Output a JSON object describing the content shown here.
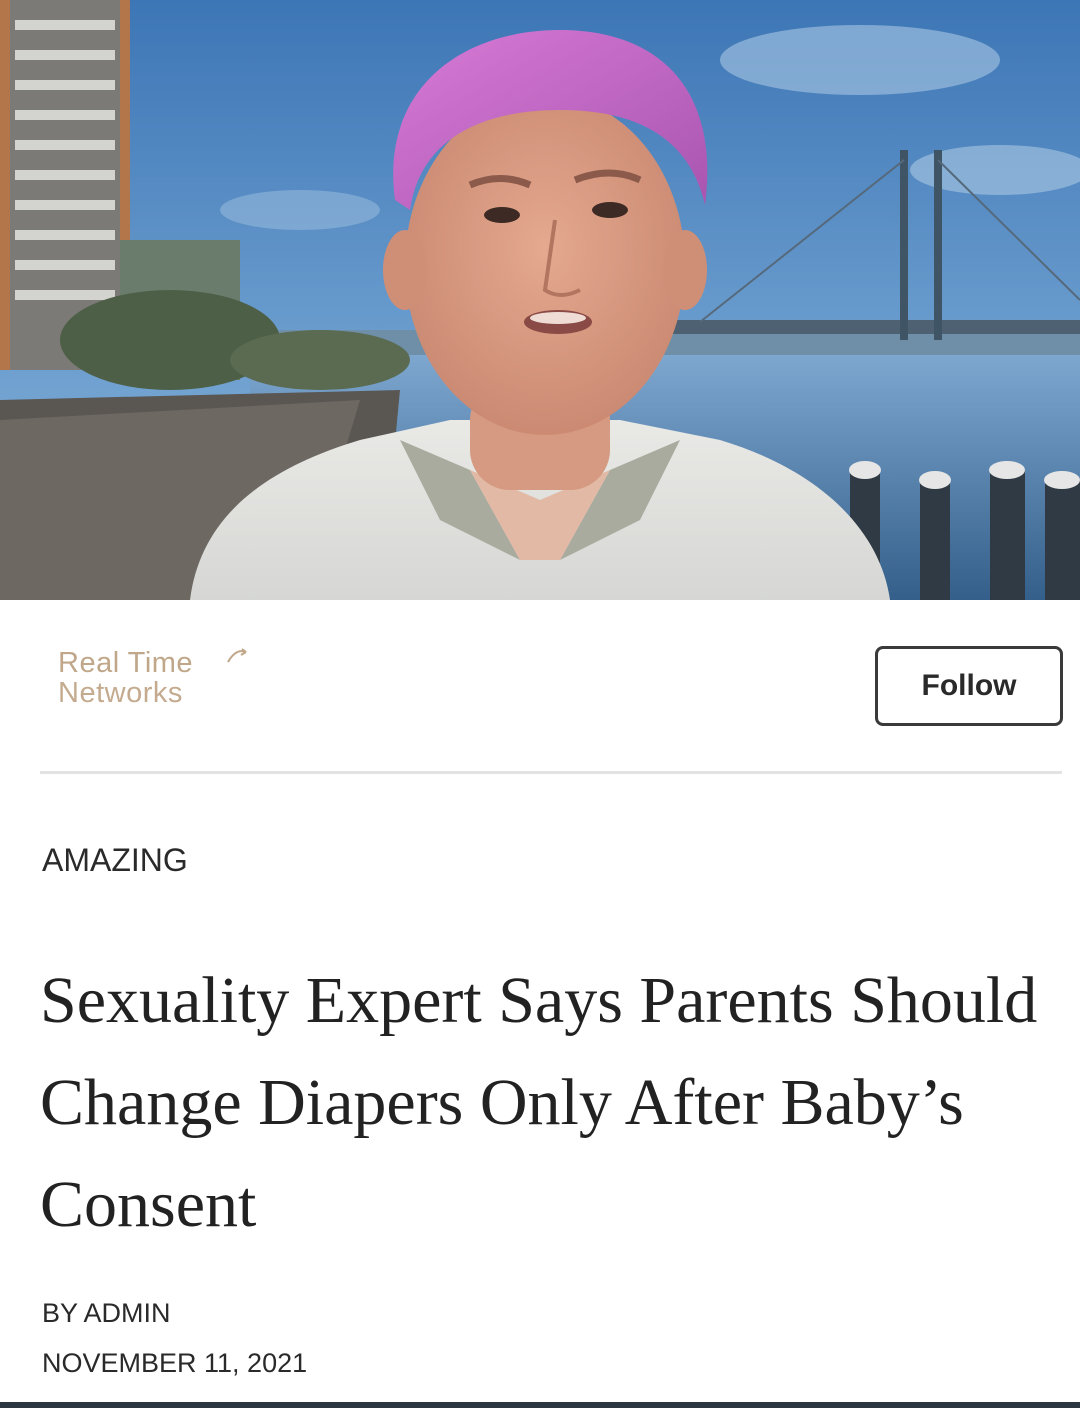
{
  "publisher": {
    "name_line1": "Real Time",
    "name_line2": "Networks",
    "follow_label": "Follow"
  },
  "article": {
    "category": "AMAZING",
    "headline": "Sexuality Expert Says Parents Should Change Diapers Only After Baby’s Consent",
    "byline": "BY ADMIN",
    "date": "NOVEMBER 11, 2021"
  },
  "colors": {
    "logo_tan": "#c0a78a",
    "text_dark": "#222222",
    "hair_pink": "#c266c6",
    "sky_blue": "#3f79b8"
  }
}
